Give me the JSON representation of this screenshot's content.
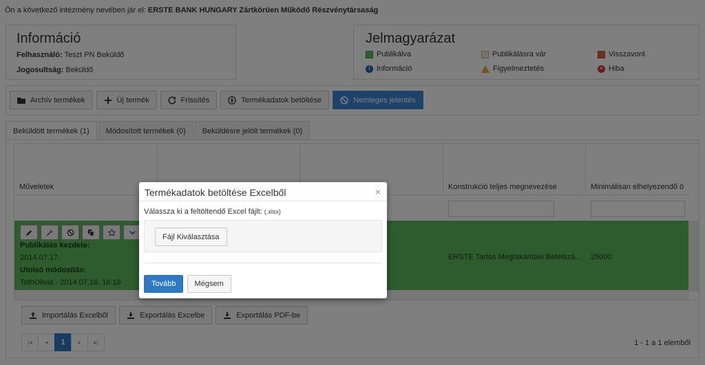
{
  "top_notice": {
    "prefix": "Ön a következő intézmény nevében jár el:",
    "institution": "ERSTE BANK HUNGARY Zártkörüen Működő Részvénytársaság"
  },
  "info": {
    "title": "Információ",
    "user_label": "Felhasználó:",
    "user_value": "Teszt PN Beküldő",
    "role_label": "Jogosultság:",
    "role_value": "Beküldő"
  },
  "legend": {
    "title": "Jelmagyarázat",
    "items": [
      {
        "label": "Publikálva",
        "color": "#5cb85c"
      },
      {
        "label": "Publikálásra vár",
        "color": "#f7e3c8"
      },
      {
        "label": "Visszavont",
        "color": "#e0613e"
      },
      {
        "label": "Információ",
        "icon": "info-icon",
        "color": "#2b5fa8"
      },
      {
        "label": "Figyelmeztetés",
        "icon": "warning-icon",
        "color": "#e8a33b"
      },
      {
        "label": "Hiba",
        "icon": "error-icon",
        "color": "#d9302c"
      }
    ]
  },
  "toolbar": {
    "archive": "Archív termékek",
    "new": "Új termék",
    "refresh": "Frissítés",
    "load": "Termékadatok betöltése",
    "null_report": "Nemleges jelentés"
  },
  "tabs": [
    {
      "label": "Beküldött termékek (1)"
    },
    {
      "label": "Módosított termékek (0)"
    },
    {
      "label": "Beküldésre jelölt termékek (0)"
    }
  ],
  "grid": {
    "headers": {
      "actions": "Műveletek",
      "construction": "Konstrukció teljes megnevezése",
      "min_deposit": "Minimálisan elhelyezendő ö"
    },
    "row": {
      "pub_start_label": "Publikálás kezdete:",
      "pub_start_value": "2014.07.17.",
      "last_mod_label": "Utolsó módosítás:",
      "last_mod_value": "TothOlivia - 2014.07.16. 16:16",
      "construction": "ERSTE Tartós Megtakarítási Betétszá...",
      "min_deposit": "25000"
    }
  },
  "bottom": {
    "import": "Importálás Excelből",
    "export_excel": "Exportálás Excelbe",
    "export_pdf": "Exportálás PDF-be"
  },
  "pager": {
    "current": "1",
    "info": "1 - 1 a 1 elemből"
  },
  "modal": {
    "title": "Termékadatok betöltése Excelből",
    "close": "×",
    "prompt": "Válassza ki a feltöltendő Excel fájlt:",
    "ext": "(.xlsx)",
    "choose_file": "Fájl Kiválasztása",
    "next": "Tovább",
    "cancel": "Mégsem"
  }
}
